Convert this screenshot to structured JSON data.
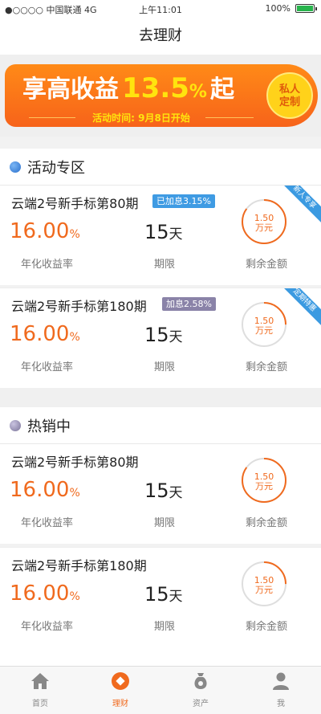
{
  "status_bar": {
    "carrier": "●○○○○ 中国联通  4G",
    "time": "上午11:01",
    "battery": "100%"
  },
  "nav": {
    "title": "去理财"
  },
  "banner": {
    "headline_prefix": "享高收益",
    "headline_rate": "13.5",
    "headline_percent": "%",
    "headline_suffix": "起",
    "subtitle": "活动时间: 9月8日开始",
    "badge_line1": "私人",
    "badge_line2": "定制",
    "colors": {
      "background": "#f7631a",
      "highlight": "#ffe40e",
      "badge": "#ffd21a"
    }
  },
  "sections": [
    {
      "title": "活动专区",
      "dot_color": "#3b7fd8",
      "products": [
        {
          "name": "云端2号新手标第80期",
          "tag": "已加息3.15%",
          "tag_color": "#3f9be3",
          "rate": "16.00",
          "rate_unit": "%",
          "rate_label": "年化收益率",
          "term": "15",
          "term_unit": "天",
          "term_label": "期限",
          "remain_amount": "1.50",
          "remain_unit": "万元",
          "remain_label": "剩余金额",
          "progress": 0.85,
          "corner": "新人专享"
        },
        {
          "name": "云端2号新手标第180期",
          "tag": "加息2.58%",
          "tag_color": "#8a83a8",
          "rate": "16.00",
          "rate_unit": "%",
          "rate_label": "年化收益率",
          "term": "15",
          "term_unit": "天",
          "term_label": "期限",
          "remain_amount": "1.50",
          "remain_unit": "万元",
          "remain_label": "剩余金额",
          "progress": 0.25,
          "corner": "定期特惠"
        }
      ]
    },
    {
      "title": "热销中",
      "dot_color": "#8a83a8",
      "products": [
        {
          "name": "云端2号新手标第80期",
          "rate": "16.00",
          "rate_unit": "%",
          "rate_label": "年化收益率",
          "term": "15",
          "term_unit": "天",
          "term_label": "期限",
          "remain_amount": "1.50",
          "remain_unit": "万元",
          "remain_label": "剩余金额",
          "progress": 0.85
        },
        {
          "name": "云端2号新手标第180期",
          "rate": "16.00",
          "rate_unit": "%",
          "rate_label": "年化收益率",
          "term": "15",
          "term_unit": "天",
          "term_label": "期限",
          "remain_amount": "1.50",
          "remain_unit": "万元",
          "remain_label": "剩余金额",
          "progress": 0.25
        }
      ]
    }
  ],
  "tab_bar": {
    "tabs": [
      {
        "label": "首页",
        "icon": "home-icon"
      },
      {
        "label": "理财",
        "icon": "finance-icon",
        "active": true
      },
      {
        "label": "资产",
        "icon": "money-bag-icon"
      },
      {
        "label": "我",
        "icon": "user-icon"
      }
    ],
    "colors": {
      "active": "#f06a1e",
      "inactive": "#888888"
    }
  }
}
